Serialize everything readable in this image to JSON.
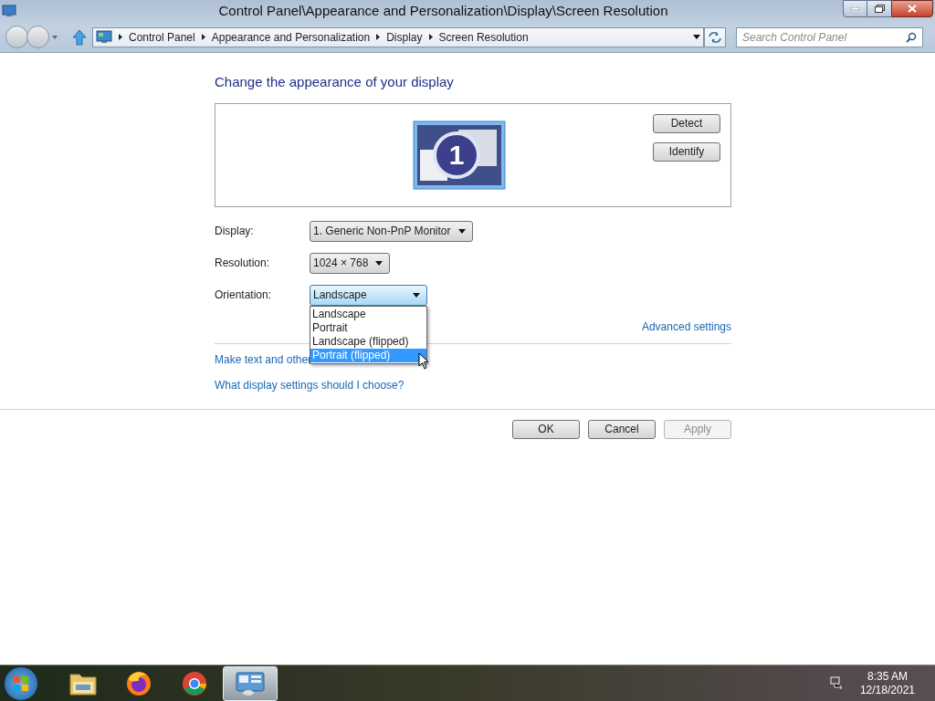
{
  "window": {
    "title": "Control Panel\\Appearance and Personalization\\Display\\Screen Resolution"
  },
  "address_bar": {
    "breadcrumbs": [
      "Control Panel",
      "Appearance and Personalization",
      "Display",
      "Screen Resolution"
    ]
  },
  "search": {
    "placeholder": "Search Control Panel"
  },
  "heading": "Change the appearance of your display",
  "monitor": {
    "label": "1",
    "selected": true
  },
  "display_buttons": [
    "Detect",
    "Identify"
  ],
  "fields": [
    {
      "label": "Display:",
      "value": "1. Generic Non-PnP Monitor",
      "open": false
    },
    {
      "label": "Resolution:",
      "value": "1024 × 768",
      "open": false
    },
    {
      "label": "Orientation:",
      "value": "Landscape",
      "open": true
    }
  ],
  "orientation_menu": [
    {
      "label": "Landscape",
      "selected": false
    },
    {
      "label": "Portrait",
      "selected": false
    },
    {
      "label": "Landscape (flipped)",
      "selected": false
    },
    {
      "label": "Portrait (flipped)",
      "selected": true
    }
  ],
  "advanced_link": "Advanced settings",
  "links": [
    "Make text and other",
    "What display settings should I choose?"
  ],
  "buttons": [
    {
      "label": "OK",
      "disabled": false
    },
    {
      "label": "Cancel",
      "disabled": false
    },
    {
      "label": "Apply",
      "disabled": true
    }
  ],
  "taskbar": {
    "apps": [
      {
        "kind": "folder",
        "selected": false
      },
      {
        "kind": "firefox",
        "selected": false
      },
      {
        "kind": "chrome",
        "selected": false
      },
      {
        "kind": "display",
        "selected": true
      }
    ],
    "time": "8:35 AM",
    "date": "12/18/2021"
  }
}
